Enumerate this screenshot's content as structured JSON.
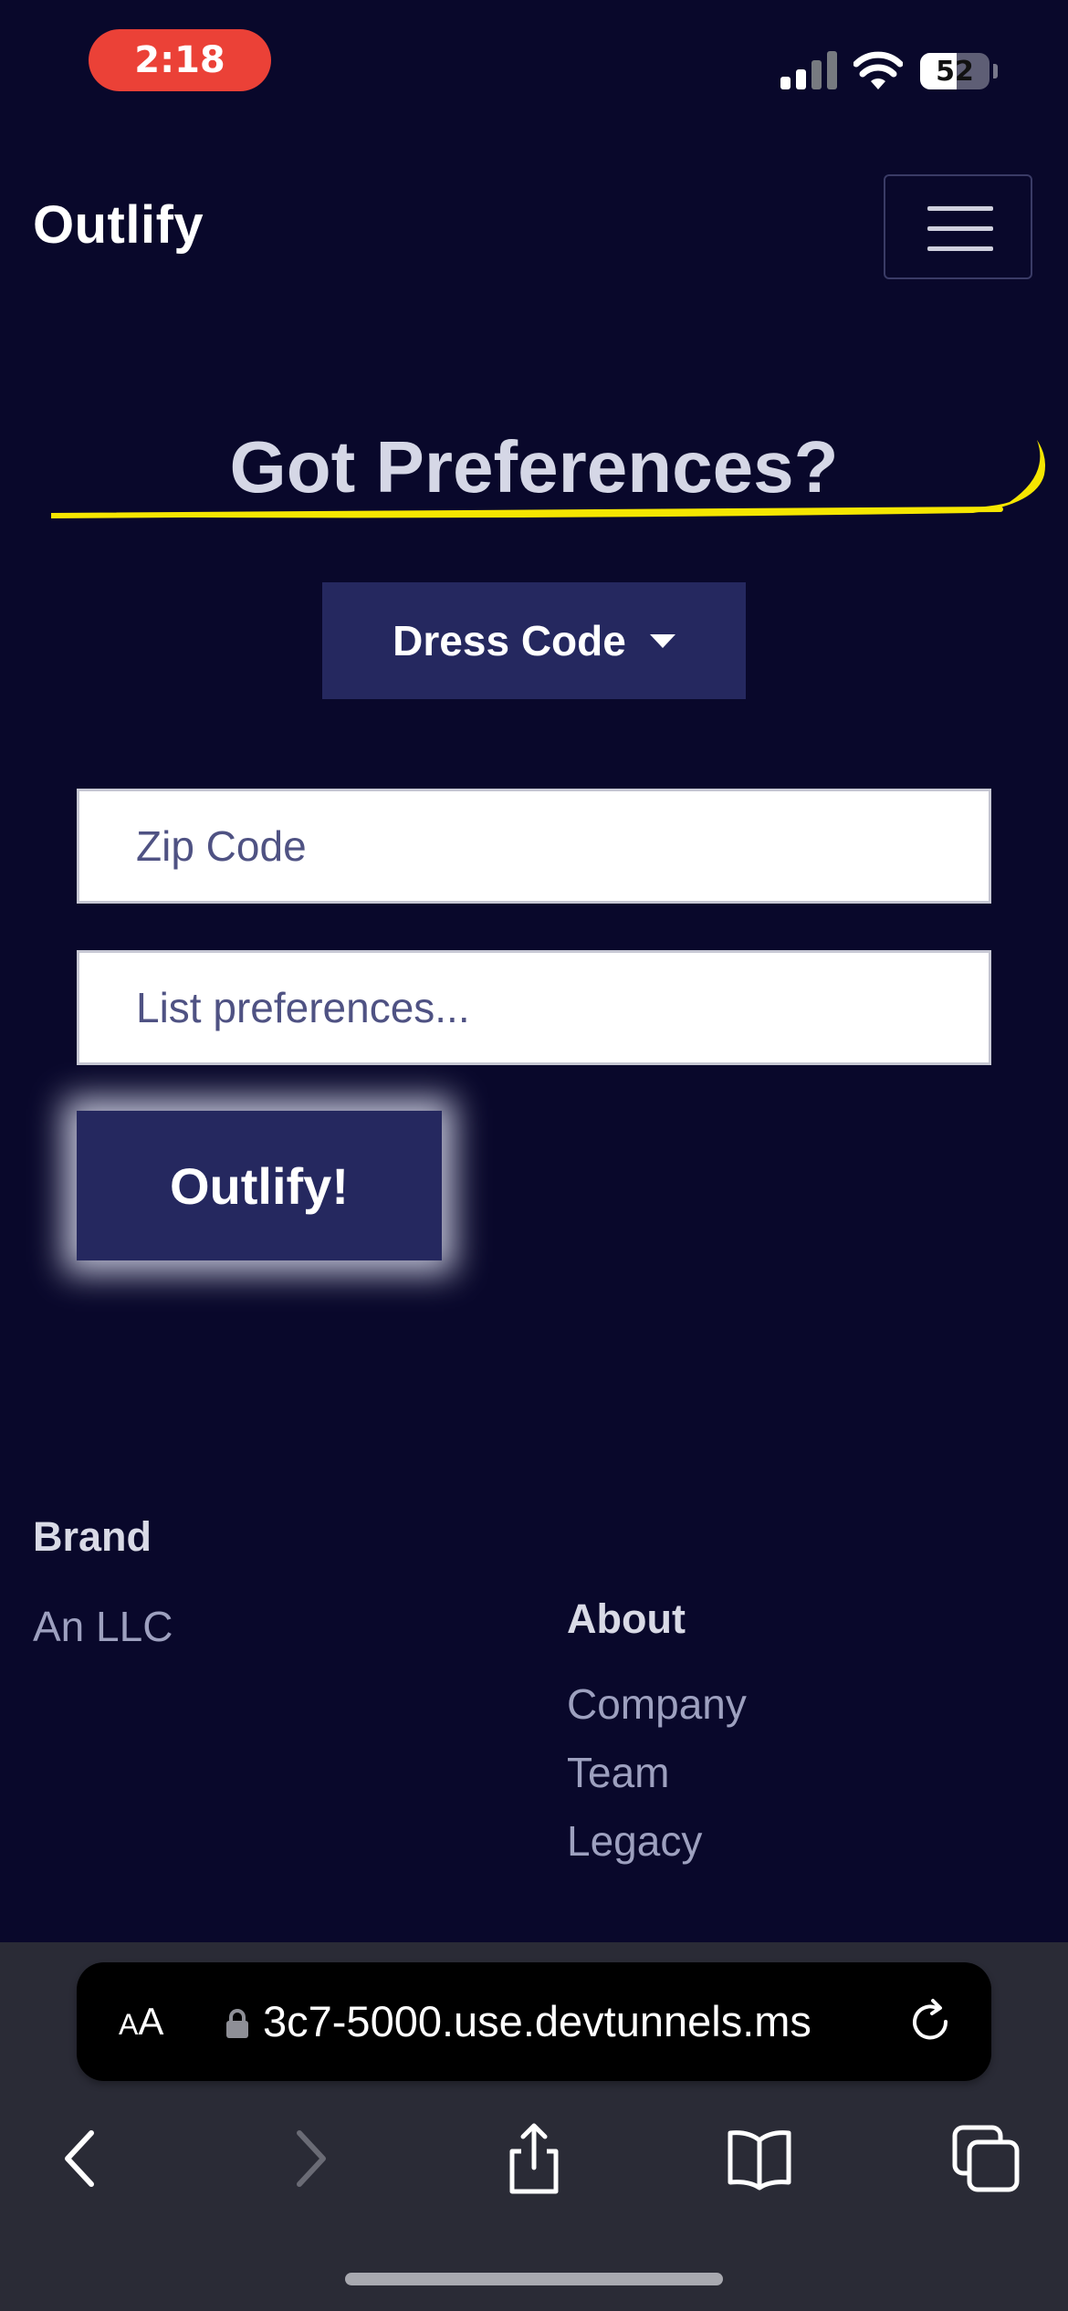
{
  "status_bar": {
    "time": "2:18",
    "battery": "52"
  },
  "navbar": {
    "brand": "Outlify"
  },
  "main": {
    "heading": "Got Preferences?",
    "dropdown_label": "Dress Code",
    "zip_placeholder": "Zip Code",
    "prefs_placeholder": "List preferences...",
    "submit_label": "Outlify!"
  },
  "footer": {
    "brand_heading": "Brand",
    "brand_text": "An LLC",
    "about_heading": "About",
    "about_links": [
      "Company",
      "Team",
      "Legacy"
    ]
  },
  "browser": {
    "aa_label_small": "A",
    "aa_label_big": "A",
    "url": "3c7-5000.use.devtunnels.ms"
  },
  "colors": {
    "background": "#09082b",
    "button": "#25285f",
    "accent": "#f5e600",
    "status_pill": "#eb4137"
  }
}
